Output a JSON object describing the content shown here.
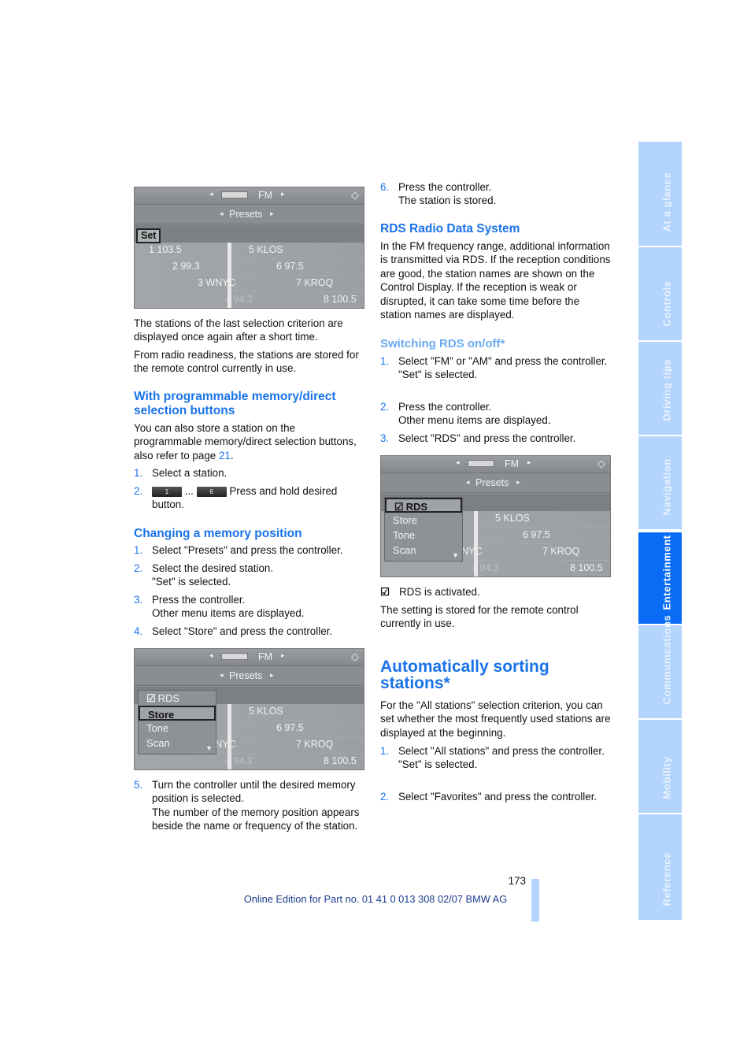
{
  "left": {
    "para1": "The stations of the last selection criterion are displayed once again after a short time.",
    "para2": "From radio readiness, the stations are stored for the remote control currently in use.",
    "heading1": "With programmable memory/direct selection buttons",
    "para3_text": "You can also store a station on the programmable memory/direct selection buttons, also refer to page ",
    "para3_link": "21",
    "para3_end": ".",
    "list1": [
      {
        "num": "1.",
        "text": "Select a station."
      },
      {
        "num": "2.",
        "btn_first": "1",
        "ellipsis": "...",
        "btn_last": "6",
        "text": "Press and hold desired button."
      }
    ],
    "heading2": "Changing a memory position",
    "list2": [
      {
        "num": "1.",
        "text": "Select \"Presets\" and press the controller."
      },
      {
        "num": "2.",
        "text": "Select the desired station.",
        "sub": "\"Set\" is selected."
      },
      {
        "num": "3.",
        "text": "Press the controller.",
        "sub": "Other menu items are displayed."
      },
      {
        "num": "4.",
        "text": "Select \"Store\" and press the controller."
      }
    ],
    "list3": [
      {
        "num": "5.",
        "text": "Turn the controller until the desired memory position is selected.",
        "sub": "The number of the memory position appears beside the name or frequency of the station."
      }
    ]
  },
  "right": {
    "list0": [
      {
        "num": "6.",
        "text": "Press the controller.",
        "sub": "The station is stored."
      }
    ],
    "heading1": "RDS Radio Data System",
    "para1": "In the FM frequency range, additional information is transmitted via RDS. If the reception conditions are good, the station names are shown on the Control Display. If the reception is weak or disrupted, it can take some time before the station names are displayed.",
    "heading2": "Switching RDS on/off*",
    "list1": [
      {
        "num": "1.",
        "text": "Select \"FM\" or \"AM\" and press the controller.",
        "sub": "\"Set\" is selected."
      },
      {
        "num": "2.",
        "text": "Press the controller.",
        "sub": "Other menu items are displayed."
      },
      {
        "num": "3.",
        "text": "Select \"RDS\" and press the controller."
      }
    ],
    "rds_active": "RDS is activated.",
    "para2": "The setting is stored for the remote control currently in use.",
    "heading3": "Automatically sorting stations*",
    "para3": "For the \"All stations\" selection criterion, you can set whether the most frequently used stations are displayed at the beginning.",
    "list2": [
      {
        "num": "1.",
        "text": "Select \"All stations\" and press the controller.",
        "sub": "\"Set\" is selected."
      },
      {
        "num": "2.",
        "text": "Select \"Favorites\" and press the controller."
      }
    ]
  },
  "screens": {
    "band": "FM",
    "presets": "Presets",
    "set": "Set",
    "left_rows": [
      "1 103.5",
      "2 99.3",
      "3 WNYC",
      "4 94.3"
    ],
    "right_rows": [
      "5 KLOS",
      "6 97.5",
      "7 KROQ",
      "8 100.5"
    ],
    "menu": [
      "RDS",
      "Store",
      "Tone",
      "Scan"
    ]
  },
  "sidebar": {
    "tabs": [
      "At a glance",
      "Controls",
      "Driving tips",
      "Navigation",
      "Entertainment",
      "Communications",
      "Mobility",
      "Reference"
    ],
    "active": "Entertainment",
    "active_color": "#0a6cf5",
    "inactive_color": "#b3d4fc"
  },
  "footer": {
    "page_number": "173",
    "edition": "Online Edition for Part no. 01 41 0 013 308 02/07 BMW AG"
  },
  "colors": {
    "accent": "#1a73e8",
    "subheading": "#6aaaf0"
  }
}
